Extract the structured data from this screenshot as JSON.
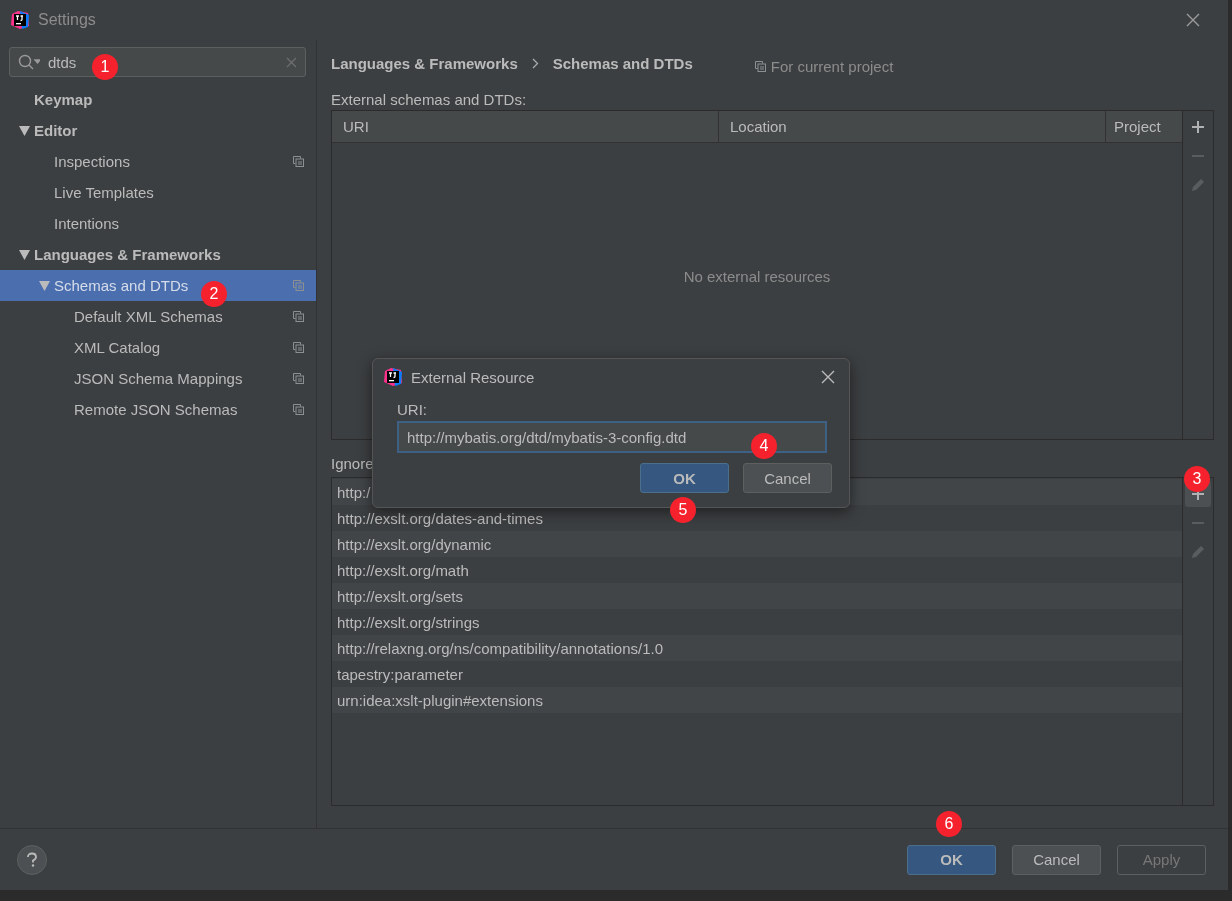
{
  "window": {
    "title": "Settings"
  },
  "search": {
    "value": "dtds"
  },
  "sidebar": {
    "items": [
      {
        "label": "Keymap",
        "bold": true,
        "expanded": false,
        "selected": false,
        "project_level": false
      },
      {
        "label": "Editor",
        "bold": true,
        "expanded": true,
        "selected": false,
        "project_level": false,
        "children": [
          {
            "label": "Inspections",
            "bold": false,
            "expanded": false,
            "selected": false,
            "project_level": true
          },
          {
            "label": "Live Templates",
            "bold": false,
            "expanded": false,
            "selected": false,
            "project_level": false
          },
          {
            "label": "Intentions",
            "bold": false,
            "expanded": false,
            "selected": false,
            "project_level": false
          }
        ]
      },
      {
        "label": "Languages & Frameworks",
        "bold": true,
        "expanded": true,
        "selected": false,
        "project_level": false,
        "children": [
          {
            "label": "Schemas and DTDs",
            "bold": false,
            "expanded": true,
            "selected": true,
            "project_level": true,
            "children": [
              {
                "label": "Default XML Schemas",
                "bold": false,
                "expanded": false,
                "selected": false,
                "project_level": true
              },
              {
                "label": "XML Catalog",
                "bold": false,
                "expanded": false,
                "selected": false,
                "project_level": true
              },
              {
                "label": "JSON Schema Mappings",
                "bold": false,
                "expanded": false,
                "selected": false,
                "project_level": true
              },
              {
                "label": "Remote JSON Schemas",
                "bold": false,
                "expanded": false,
                "selected": false,
                "project_level": true
              }
            ]
          }
        ]
      }
    ]
  },
  "breadcrumb": [
    "Languages & Frameworks",
    "Schemas and DTDs"
  ],
  "scope_hint": "For current project",
  "external_table": {
    "label": "External schemas and DTDs:",
    "columns": [
      "URI",
      "Location",
      "Project"
    ],
    "empty_text": "No external resources",
    "toolbar": [
      {
        "kind": "add",
        "disabled": false
      },
      {
        "kind": "remove",
        "disabled": true
      },
      {
        "kind": "edit",
        "disabled": true
      }
    ]
  },
  "ignored_table": {
    "label": "Ignore",
    "rows": [
      "http:/",
      "http://exslt.org/dates-and-times",
      "http://exslt.org/dynamic",
      "http://exslt.org/math",
      "http://exslt.org/sets",
      "http://exslt.org/strings",
      "http://relaxng.org/ns/compatibility/annotations/1.0",
      "tapestry:parameter",
      "urn:idea:xslt-plugin#extensions"
    ],
    "toolbar": [
      {
        "kind": "add",
        "disabled": false
      },
      {
        "kind": "remove",
        "disabled": true
      },
      {
        "kind": "edit",
        "disabled": true
      }
    ]
  },
  "buttons": [
    {
      "label": "OK",
      "default": true,
      "disabled": false
    },
    {
      "label": "Cancel",
      "default": false,
      "disabled": false
    },
    {
      "label": "Apply",
      "default": false,
      "disabled": true
    }
  ],
  "dialog": {
    "title": "External Resource",
    "field_label": "URI:",
    "value": "http://mybatis.org/dtd/mybatis-3-config.dtd",
    "buttons": [
      {
        "label": "OK",
        "default": true
      },
      {
        "label": "Cancel",
        "default": false
      }
    ]
  },
  "annotations": [
    "1",
    "2",
    "3",
    "4",
    "5",
    "6"
  ]
}
